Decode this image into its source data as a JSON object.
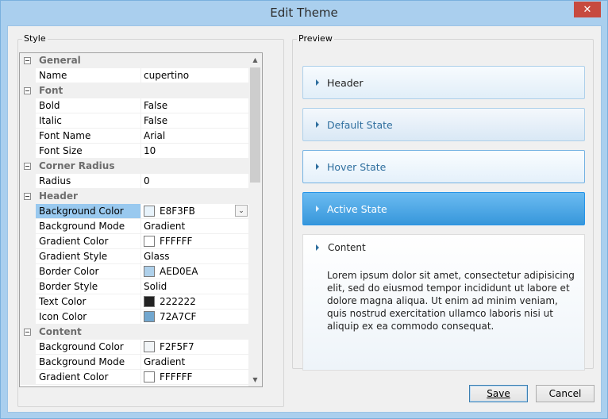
{
  "window": {
    "title": "Edit Theme",
    "close_glyph": "✕"
  },
  "style_group": {
    "legend": "Style"
  },
  "preview_group": {
    "legend": "Preview"
  },
  "properties": [
    {
      "type": "category",
      "label": "General"
    },
    {
      "type": "prop",
      "label": "Name",
      "value": "cupertino"
    },
    {
      "type": "category",
      "label": "Font"
    },
    {
      "type": "prop",
      "label": "Bold",
      "value": "False"
    },
    {
      "type": "prop",
      "label": "Italic",
      "value": "False"
    },
    {
      "type": "prop",
      "label": "Font Name",
      "value": "Arial"
    },
    {
      "type": "prop",
      "label": "Font Size",
      "value": "10"
    },
    {
      "type": "category",
      "label": "Corner Radius"
    },
    {
      "type": "prop",
      "label": "Radius",
      "value": "0"
    },
    {
      "type": "category",
      "label": "Header"
    },
    {
      "type": "prop",
      "label": "Background Color",
      "value": "E8F3FB",
      "swatch": "#E8F3FB",
      "selected": true,
      "dropdown": true
    },
    {
      "type": "prop",
      "label": "Background Mode",
      "value": "Gradient"
    },
    {
      "type": "prop",
      "label": "Gradient Color",
      "value": "FFFFFF",
      "swatch": "#FFFFFF"
    },
    {
      "type": "prop",
      "label": "Gradient Style",
      "value": "Glass"
    },
    {
      "type": "prop",
      "label": "Border Color",
      "value": "AED0EA",
      "swatch": "#AED0EA"
    },
    {
      "type": "prop",
      "label": "Border Style",
      "value": "Solid"
    },
    {
      "type": "prop",
      "label": "Text Color",
      "value": "222222",
      "swatch": "#222222"
    },
    {
      "type": "prop",
      "label": "Icon Color",
      "value": "72A7CF",
      "swatch": "#72A7CF"
    },
    {
      "type": "category",
      "label": "Content"
    },
    {
      "type": "prop",
      "label": "Background Color",
      "value": "F2F5F7",
      "swatch": "#F2F5F7"
    },
    {
      "type": "prop",
      "label": "Background Mode",
      "value": "Gradient"
    },
    {
      "type": "prop",
      "label": "Gradient Color",
      "value": "FFFFFF",
      "swatch": "#FFFFFF"
    }
  ],
  "scrollbar": {
    "up_glyph": "▲",
    "down_glyph": "▼"
  },
  "preview": {
    "header": "Header",
    "default_state": "Default State",
    "hover_state": "Hover State",
    "active_state": "Active State",
    "content_title": "Content",
    "content_text": "Lorem ipsum dolor sit amet, consectetur adipisicing elit, sed do eiusmod tempor incididunt ut labore et dolore magna aliqua. Ut enim ad minim veniam, quis nostrud exercitation ullamco laboris nisi ut aliquip ex ea commodo consequat."
  },
  "buttons": {
    "save": "Save",
    "cancel": "Cancel"
  },
  "colors": {
    "accent": "#3797DB",
    "title_bar": "#AACFEE",
    "close": "#C74A3F"
  }
}
